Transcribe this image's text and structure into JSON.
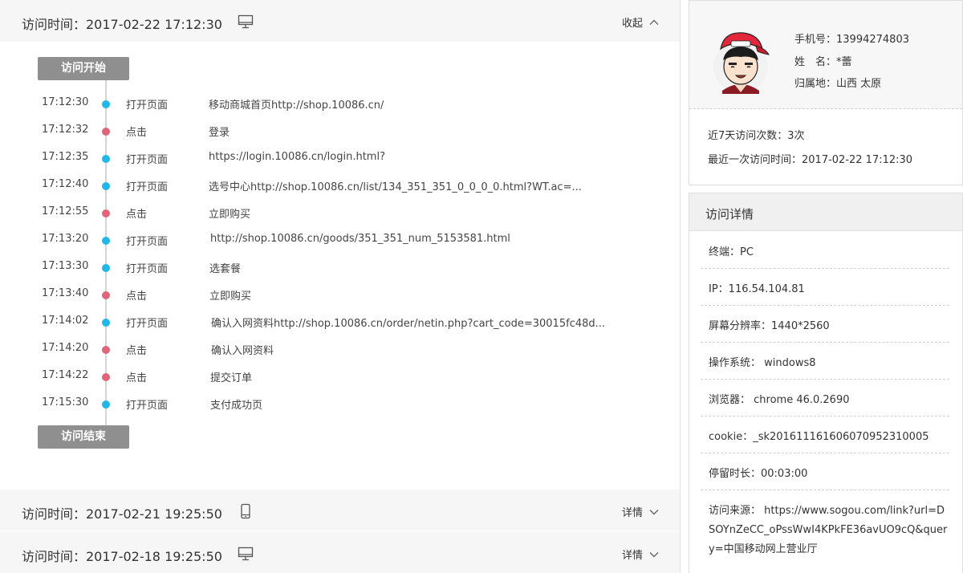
{
  "visits": [
    {
      "label": "访问时间：2017-02-22 17:12:30",
      "device": "desktop-icon",
      "toggle": "收起",
      "expanded": true
    },
    {
      "label": "访问时间：2017-02-21 19:25:50",
      "device": "mobile-icon",
      "toggle": "详情",
      "expanded": false
    },
    {
      "label": "访问时间：2017-02-18 19:25:50",
      "device": "desktop-icon",
      "toggle": "详情",
      "expanded": false
    }
  ],
  "timeline": {
    "start_label": "访问开始",
    "end_label": "访问结束",
    "rows": [
      {
        "time": "17:12:30",
        "type": "open",
        "action": "打开页面",
        "target": "移动商城首页http://shop.10086.cn/"
      },
      {
        "time": "17:12:32",
        "type": "click",
        "action": "点击",
        "target": "登录"
      },
      {
        "time": "17:12:35",
        "type": "open",
        "action": "打开页面",
        "target": "https://login.10086.cn/login.html?"
      },
      {
        "time": "17:12:40",
        "type": "open",
        "action": "打开页面",
        "target": "选号中心http://shop.10086.cn/list/134_351_351_0_0_0_0.html?WT.ac=..."
      },
      {
        "time": "17:12:55",
        "type": "click",
        "action": "点击",
        "target": "立即购买"
      },
      {
        "time": "17:13:20",
        "type": "open",
        "action": "打开页面",
        "target": "http://shop.10086.cn/goods/351_351_num_5153581.html"
      },
      {
        "time": "17:13:30",
        "type": "open",
        "action": "打开页面",
        "target": "选套餐"
      },
      {
        "time": "17:13:40",
        "type": "click",
        "action": "点击",
        "target": "立即购买"
      },
      {
        "time": "17:14:02",
        "type": "open",
        "action": "打开页面",
        "target": "确认入网资料http://shop.10086.cn/order/netin.php?cart_code=30015fc48d..."
      },
      {
        "time": "17:14:20",
        "type": "click",
        "action": "点击",
        "target": "确认入网资料"
      },
      {
        "time": "17:14:22",
        "type": "click",
        "action": "点击",
        "target": "提交订单"
      },
      {
        "time": "17:15:30",
        "type": "open",
        "action": "打开页面",
        "target": "支付成功页"
      }
    ]
  },
  "profile": {
    "phone": "手机号：13994274803",
    "name": "姓　名：*蕾",
    "location": "归属地：山西  太原",
    "visits7": "近7天访问次数：3次",
    "last_visit": "最近一次访问时间：2017-02-22  17:12:30"
  },
  "details": {
    "title": "访问详情",
    "terminal": "终端：PC",
    "ip": "IP：116.54.104.81",
    "resolution": "屏幕分辨率：1440*2560",
    "os": "操作系统：   windows8",
    "browser": "浏览器：      chrome 46.0.2690",
    "cookie": "cookie：_sk201611161606070952310005",
    "duration": "停留时长：00:03:00",
    "source": "访问来源：   https://www.sogou.com/link?url=DSOYnZeCC_oPssWwI4KPkFE36avUO9cQ&query=中国移动网上营业厅"
  },
  "colors": {
    "open_dot": "#1fb8e8",
    "click_dot": "#e36479",
    "tag_bg": "#8f8f8f"
  }
}
